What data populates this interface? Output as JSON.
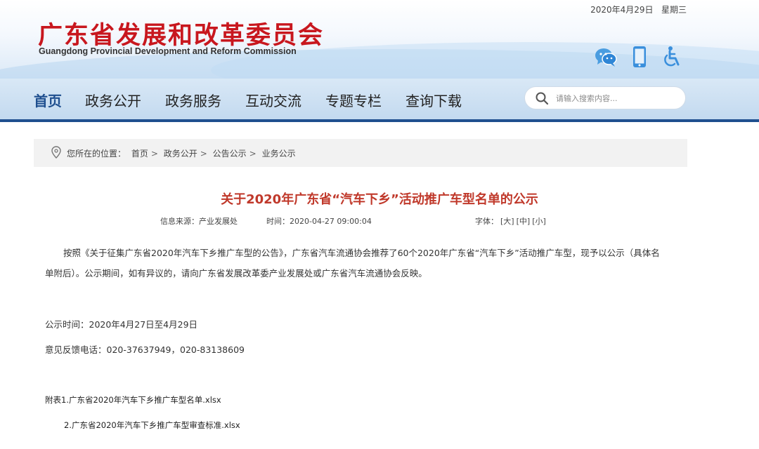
{
  "header": {
    "date": "2020年4月29日",
    "weekday": "星期三",
    "site_title": "广东省发展和改革委员会",
    "site_subtitle": "Guangdong Provincial Development and Reform Commission",
    "title_color": "#c8171e",
    "tools": [
      "wechat-icon",
      "mobile-icon",
      "accessibility-icon"
    ]
  },
  "nav": {
    "items": [
      "首页",
      "政务公开",
      "政务服务",
      "互动交流",
      "专题专栏",
      "查询下载"
    ],
    "active_index": 0,
    "search_placeholder": "请输入搜索内容..."
  },
  "breadcrumb": {
    "prefix": "您所在的位置：",
    "items": [
      "首页",
      "政务公开",
      "公告公示",
      "业务公示"
    ],
    "separator": ">"
  },
  "article": {
    "title": "关于2020年广东省“汽车下乡”活动推广车型名单的公示",
    "source_label": "信息来源：产业发展处",
    "time_label": "时间：2020-04-27 09:00:04",
    "font_label": "字体：",
    "font_sizes": [
      "[大]",
      "[中]",
      "[小]"
    ],
    "paragraph_line1": "按照《关于征集广东省2020年汽车下乡推广车型的公告》，广东省汽车流通协会推荐了60个2020年广东省“汽车下乡”活动推广车型，现予以公示（具体名",
    "paragraph_line2": "单附后）。公示期间，如有异议的，请向广东省发展改革委产业发展处或广东省汽车流通协会反映。",
    "notice_period": "公示时间：2020年4月27日至4月29日",
    "feedback_phone": "意见反馈电话：020-37637949，020-83138609",
    "attachment_1": "附表1.广东省2020年汽车下乡推广车型名单.xlsx",
    "attachment_2": "2.广东省2020年汽车下乡推广车型审查标准.xlsx"
  },
  "colors": {
    "nav_active": "#1f4f8f",
    "article_title": "#c0392b"
  }
}
